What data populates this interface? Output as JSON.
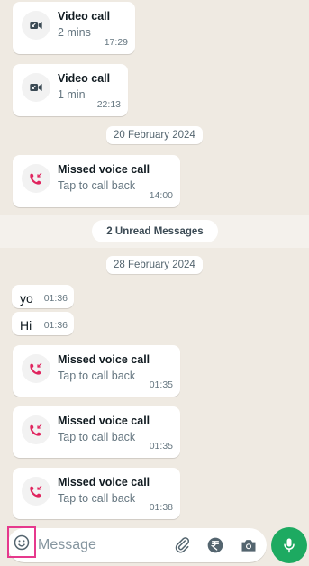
{
  "messages": [
    {
      "title": "Video call",
      "subtitle": "2 mins",
      "time": "17:29"
    },
    {
      "title": "Video call",
      "subtitle": "1 min",
      "time": "22:13"
    },
    {
      "title": "Missed voice call",
      "subtitle": "Tap to call back",
      "time": "14:00"
    },
    {
      "text": "yo",
      "time": "01:36"
    },
    {
      "text": "Hi",
      "time": "01:36"
    },
    {
      "title": "Missed voice call",
      "subtitle": "Tap to call back",
      "time": "01:35"
    },
    {
      "title": "Missed voice call",
      "subtitle": "Tap to call back",
      "time": "01:35"
    },
    {
      "title": "Missed voice call",
      "subtitle": "Tap to call back",
      "time": "01:38"
    }
  ],
  "dates": [
    "20 February 2024",
    "28 February 2024"
  ],
  "unread_label": "2 Unread Messages",
  "input": {
    "placeholder": "Message",
    "value": ""
  },
  "icons": {
    "video": "video-call-icon",
    "missed": "missed-call-icon",
    "emoji": "emoji-icon",
    "attach": "attach-icon",
    "payment": "rupee-payment-icon",
    "camera": "camera-icon",
    "mic": "mic-icon"
  },
  "colors": {
    "missed": "#e0245e",
    "accent": "#1daa61",
    "highlight": "#e6398d"
  }
}
